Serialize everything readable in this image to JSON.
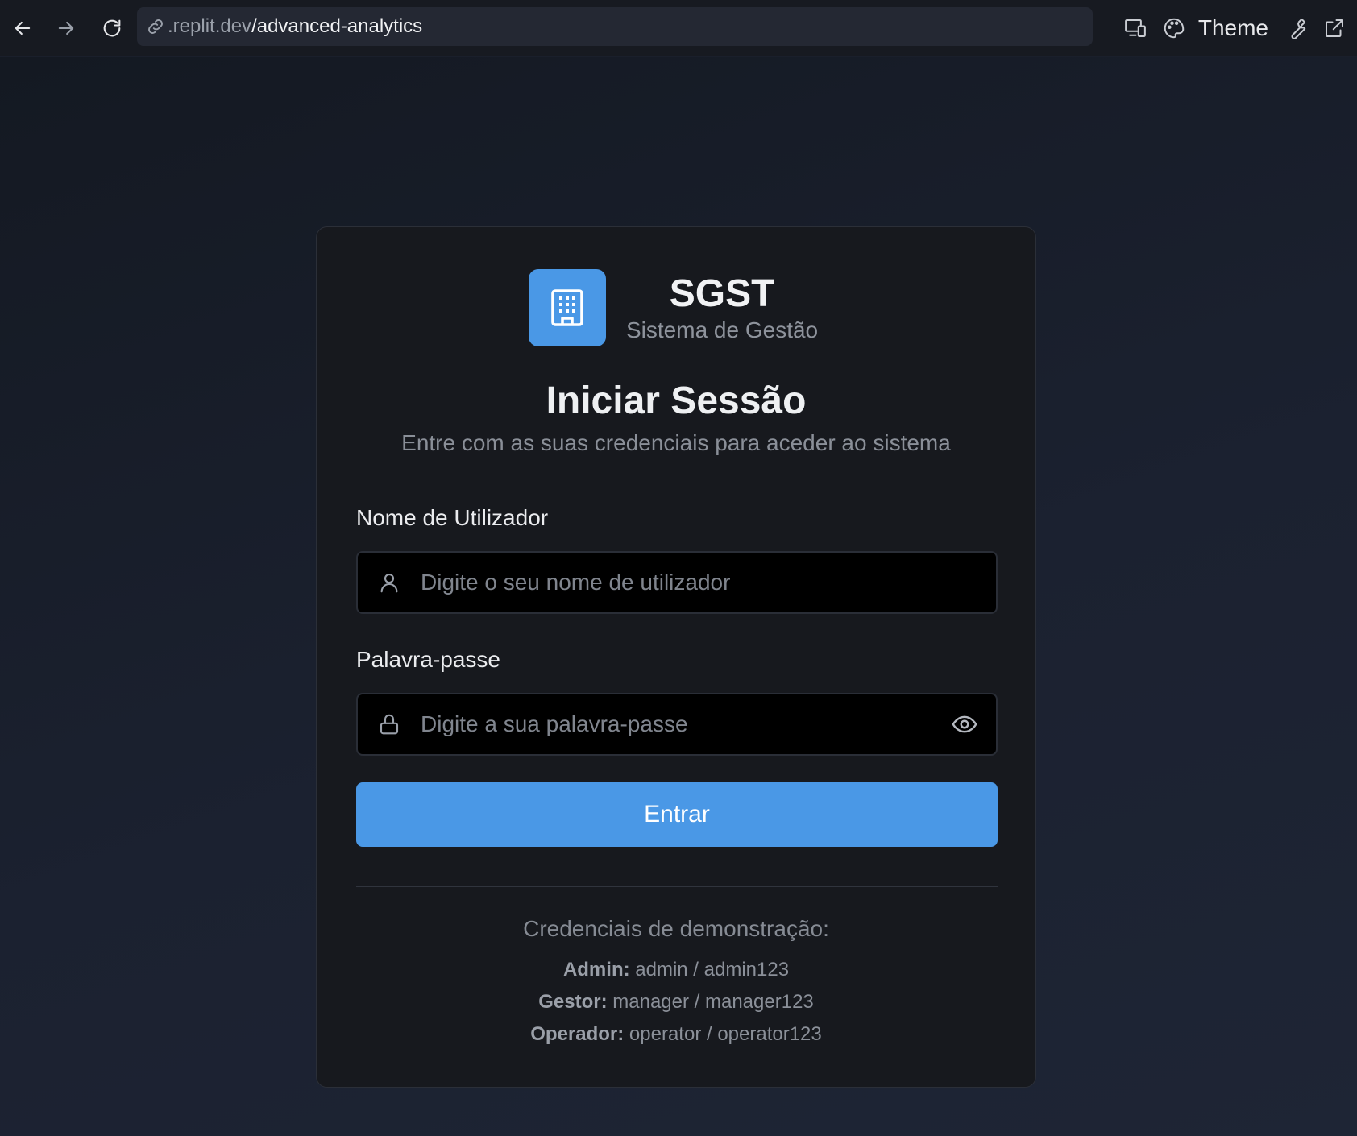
{
  "browser": {
    "url_host": ".replit.dev",
    "url_path": "/advanced-analytics",
    "theme_label": "Theme"
  },
  "brand": {
    "name": "SGST",
    "subtitle": "Sistema de Gestão",
    "logo_icon": "building-icon",
    "accent_color": "#4a98e6"
  },
  "login": {
    "title": "Iniciar Sessão",
    "subtitle": "Entre com as suas credenciais para aceder ao sistema",
    "username": {
      "label": "Nome de Utilizador",
      "placeholder": "Digite o seu nome de utilizador",
      "value": ""
    },
    "password": {
      "label": "Palavra-passe",
      "placeholder": "Digite a sua palavra-passe",
      "value": ""
    },
    "submit_label": "Entrar"
  },
  "demo": {
    "title": "Credenciais de demonstração:",
    "items": [
      {
        "role": "Admin:",
        "credentials": "admin / admin123"
      },
      {
        "role": "Gestor:",
        "credentials": "manager / manager123"
      },
      {
        "role": "Operador:",
        "credentials": "operator / operator123"
      }
    ]
  }
}
